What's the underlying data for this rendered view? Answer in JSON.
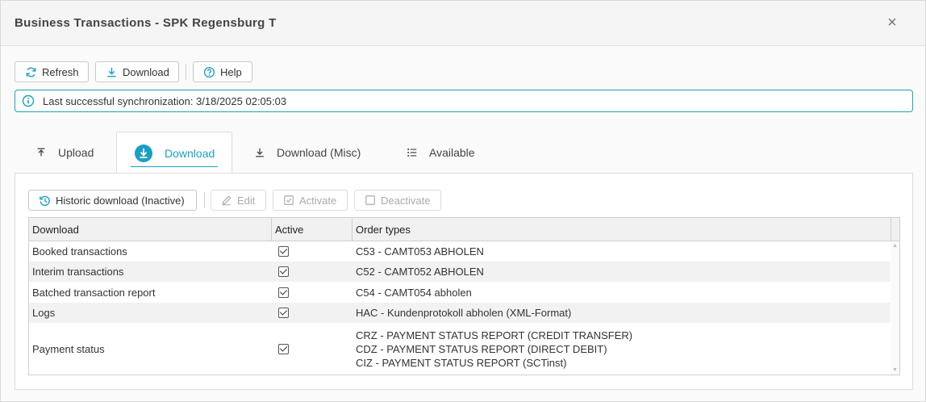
{
  "window": {
    "title": "Business Transactions - SPK Regensburg T",
    "close_label": "×"
  },
  "toolbar": {
    "refresh_label": "Refresh",
    "download_label": "Download",
    "help_label": "Help"
  },
  "info": {
    "sync_text": "Last successful synchronization: 3/18/2025 02:05:03"
  },
  "tabs": [
    {
      "label": "Upload",
      "icon": "upload-icon",
      "active": false
    },
    {
      "label": "Download",
      "icon": "download-circle-icon",
      "active": true
    },
    {
      "label": "Download (Misc)",
      "icon": "download-icon",
      "active": false
    },
    {
      "label": "Available",
      "icon": "list-icon",
      "active": false
    }
  ],
  "subtoolbar": {
    "historic_label": "Historic download (Inactive)",
    "edit_label": "Edit",
    "activate_label": "Activate",
    "deactivate_label": "Deactivate"
  },
  "grid": {
    "columns": [
      "Download",
      "Active",
      "Order types"
    ],
    "rows": [
      {
        "download": "Booked transactions",
        "active": true,
        "order_types": [
          "C53 - CAMT053 ABHOLEN"
        ]
      },
      {
        "download": "Interim transactions",
        "active": true,
        "order_types": [
          "C52 - CAMT052 ABHOLEN"
        ]
      },
      {
        "download": "Batched transaction report",
        "active": true,
        "order_types": [
          "C54 - CAMT054 abholen"
        ]
      },
      {
        "download": "Logs",
        "active": true,
        "order_types": [
          "HAC - Kundenprotokoll abholen (XML-Format)"
        ]
      },
      {
        "download": "Payment status",
        "active": true,
        "order_types": [
          "CRZ - PAYMENT STATUS REPORT (CREDIT TRANSFER)",
          "CDZ - PAYMENT STATUS REPORT (DIRECT DEBIT)",
          "CIZ - PAYMENT STATUS REPORT (SCTinst)"
        ]
      }
    ]
  },
  "colors": {
    "accent": "#1a9fc4",
    "info_border": "#1ba5b8"
  }
}
